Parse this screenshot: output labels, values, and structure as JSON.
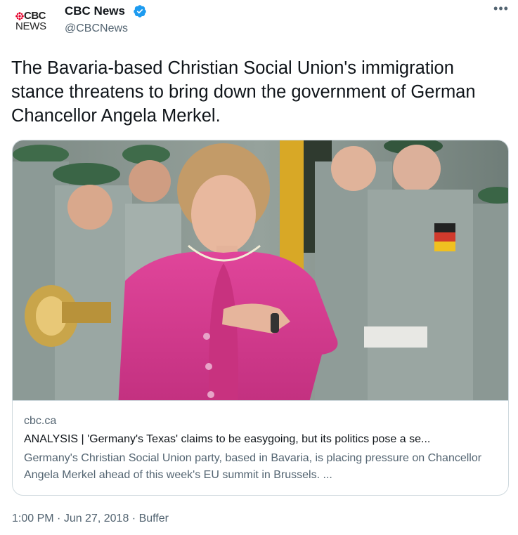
{
  "author": {
    "name": "CBC News",
    "handle": "@CBCNews",
    "verified": true,
    "avatar": {
      "line1": "CBC",
      "line2": "NEWS"
    }
  },
  "menu_icon": "more-dots-icon",
  "tweet": {
    "text": "The Bavaria-based Christian Social Union's immigration stance threatens to bring down the government of German Chancellor Angela Merkel."
  },
  "card": {
    "image_description": "photo",
    "domain": "cbc.ca",
    "title": "ANALYSIS | 'Germany's Texas' claims to be easygoing, but its politics pose a se...",
    "description": "Germany's Christian Social Union party, based in Bavaria, is placing pressure on Chancellor Angela Merkel ahead of this week's EU summit in Brussels. ..."
  },
  "meta": {
    "time": "1:00 PM",
    "date": "Jun 27, 2018",
    "source": "Buffer",
    "separator": " · "
  },
  "colors": {
    "text": "#0f1419",
    "secondary": "#536471",
    "border": "#cfd9de",
    "verified": "#1d9bf0",
    "cbc_red": "#e4002b"
  }
}
